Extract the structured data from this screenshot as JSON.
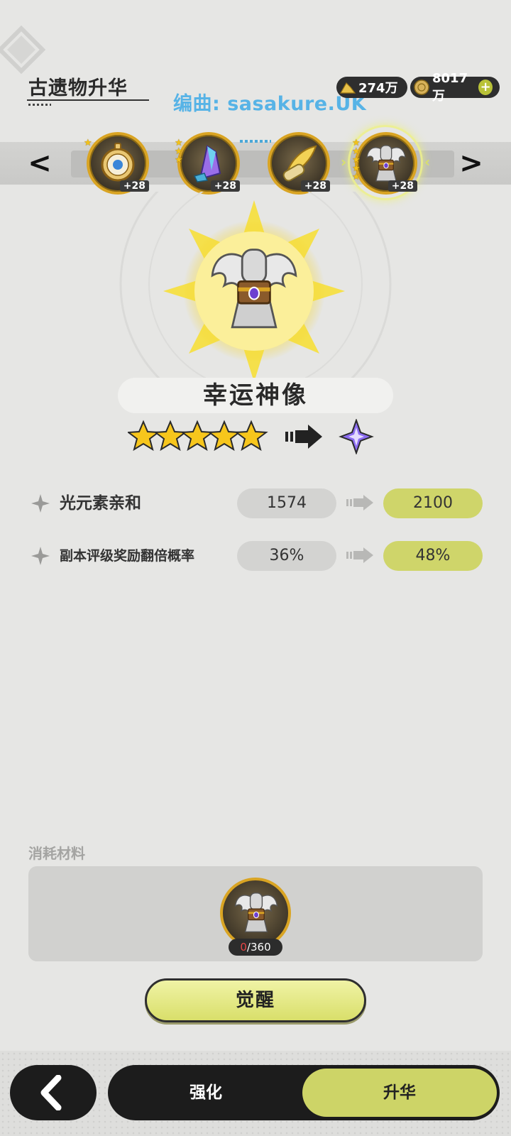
{
  "header": {
    "title": "古遗物升华",
    "watermark": "编曲: sasakure.UK",
    "currencies": [
      {
        "icon": "gold-pile-icon",
        "amount": "274万"
      },
      {
        "icon": "gold-coin-icon",
        "amount": "8017万"
      }
    ]
  },
  "relic_strip": {
    "items": [
      {
        "icon": "pocket-watch-icon",
        "level": "+28",
        "stars": 1
      },
      {
        "icon": "crystal-icon",
        "level": "+28",
        "stars": 3
      },
      {
        "icon": "golden-feather-icon",
        "level": "+28",
        "stars": 0
      },
      {
        "icon": "angel-statue-icon",
        "level": "+28",
        "stars": 5,
        "selected": true
      }
    ]
  },
  "relic": {
    "name": "幸运神像",
    "icon": "angel-statue-icon",
    "current_stars": 5,
    "next_rank": "purple-star"
  },
  "stats": [
    {
      "label": "光元素亲和",
      "old": "1574",
      "new": "2100"
    },
    {
      "label": "副本评级奖励翻倍概率",
      "old": "36%",
      "new": "48%"
    }
  ],
  "materials": {
    "title": "消耗材料",
    "item_icon": "angel-statue-icon",
    "current": "0",
    "required": "/360"
  },
  "actions": {
    "awaken_label": "觉醒"
  },
  "bottom_nav": {
    "back_icon": "chevron-left-icon",
    "tabs": [
      {
        "label": "强化",
        "active": false
      },
      {
        "label": "升华",
        "active": true
      }
    ]
  },
  "colors": {
    "accent": "#cdd467",
    "watermark": "#57b3e6",
    "material_current": "#e64545"
  }
}
